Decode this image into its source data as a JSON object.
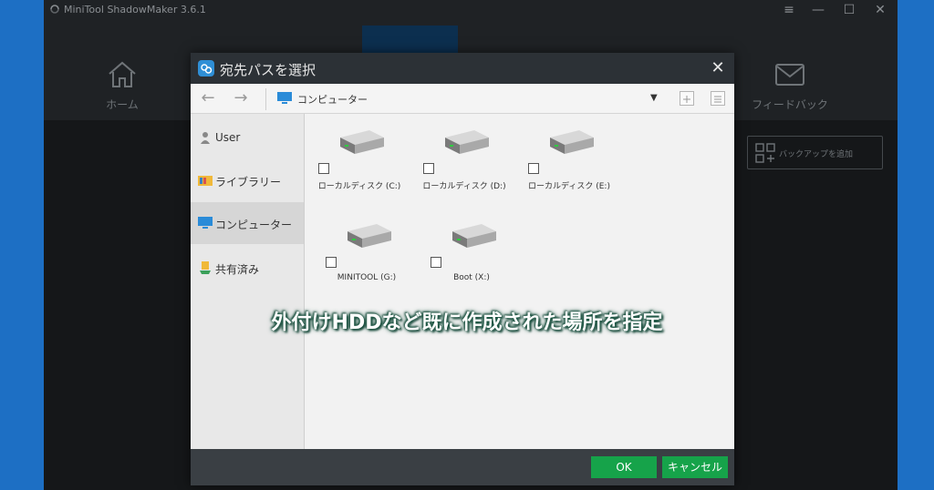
{
  "app": {
    "title": "MiniTool ShadowMaker 3.6.1",
    "nav": {
      "home_label": "ホーム",
      "feedback_label": "フィードバック"
    },
    "add_backup_label": "バックアップを追加"
  },
  "dialog": {
    "title": "宛先パスを選択",
    "path": "コンピューター",
    "sidebar": [
      {
        "label": "User",
        "icon": "user-icon",
        "active": false
      },
      {
        "label": "ライブラリー",
        "icon": "library-folder-icon",
        "active": false
      },
      {
        "label": "コンピューター",
        "icon": "computer-icon",
        "active": true
      },
      {
        "label": "共有済み",
        "icon": "shared-icon",
        "active": false
      }
    ],
    "drives": [
      {
        "label": "ローカルディスク (C:)"
      },
      {
        "label": "ローカルディスク (D:)"
      },
      {
        "label": "ローカルディスク (E:)"
      },
      {
        "label": "MINITOOL (G:)"
      },
      {
        "label": "Boot (X:)"
      }
    ],
    "buttons": {
      "ok": "OK",
      "cancel": "キャンセル"
    }
  },
  "caption": "外付けHDDなど既に作成された場所を指定",
  "colors": {
    "accent_green": "#16a34a",
    "background_blue": "#1d6fc4",
    "dialog_title_bg": "#2c3136"
  }
}
